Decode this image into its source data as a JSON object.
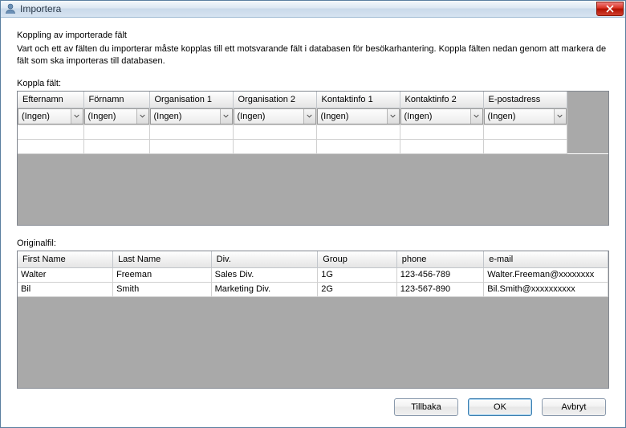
{
  "window": {
    "title": "Importera"
  },
  "instructions": {
    "heading": "Koppling av importerade fält",
    "body": "Vart och ett av fälten du importerar måste kopplas till ett motsvarande fält i databasen för besökarhantering. Koppla fälten nedan genom att markera de fält som ska importeras till databasen."
  },
  "mapping": {
    "label": "Koppla fält:",
    "columns": [
      "Efternamn",
      "Förnamn",
      "Organisation 1",
      "Organisation 2",
      "Kontaktinfo 1",
      "Kontaktinfo 2",
      "E-postadress"
    ],
    "dropdowns": [
      "(Ingen)",
      "(Ingen)",
      "(Ingen)",
      "(Ingen)",
      "(Ingen)",
      "(Ingen)",
      "(Ingen)"
    ]
  },
  "original": {
    "label": "Originalfil:",
    "columns": [
      "First Name",
      "Last Name",
      "Div.",
      "Group",
      "phone",
      "e-mail"
    ],
    "rows": [
      [
        "Walter",
        "Freeman",
        "Sales Div.",
        "1G",
        "123-456-789",
        "Walter.Freeman@xxxxxxxx"
      ],
      [
        "Bil",
        "Smith",
        "Marketing Div.",
        "2G",
        "123-567-890",
        "Bil.Smith@xxxxxxxxxx"
      ]
    ]
  },
  "buttons": {
    "back": "Tillbaka",
    "ok": "OK",
    "cancel": "Avbryt"
  }
}
